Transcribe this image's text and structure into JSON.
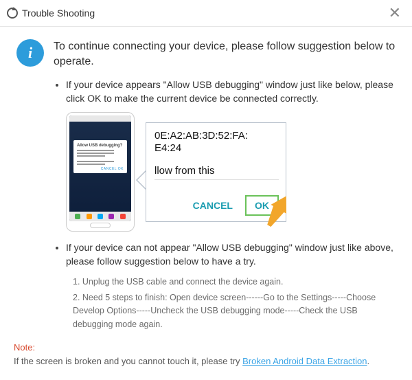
{
  "titlebar": {
    "title": "Trouble Shooting"
  },
  "info": {
    "badge": "i",
    "lead": "To continue connecting your device, please follow suggestion below to operate."
  },
  "items": [
    {
      "text": "If your device appears \"Allow USB debugging\" window just like below, please click OK to make the current device  be connected correctly."
    },
    {
      "text": "If your device can not appear \"Allow USB debugging\" window just like above, please follow suggestion below to have a try."
    }
  ],
  "phone_modal": {
    "title": "Allow USB debugging?",
    "btns": "CANCEL   OK"
  },
  "callout": {
    "fingerprint_l1": "0E:A2:AB:3D:52:FA:",
    "fingerprint_l2": "E4:24",
    "allow_from": "llow from this",
    "cancel": "CANCEL",
    "ok": "OK"
  },
  "steps": {
    "s1": "1. Unplug the USB cable and connect the device again.",
    "s2": "2. Need 5 steps to finish: Open device screen------Go to the Settings-----Choose Develop Options-----Uncheck the USB debugging mode-----Check the USB debugging mode again."
  },
  "note": {
    "label": "Note:",
    "text": "If the screen is broken and you cannot touch it, please try ",
    "link": "Broken Android Data Extraction",
    "after": "."
  }
}
